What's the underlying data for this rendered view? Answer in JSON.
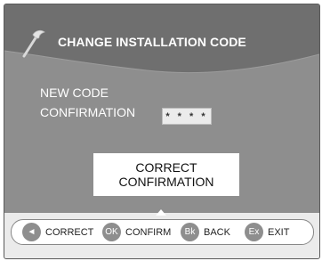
{
  "header": {
    "title": "CHANGE INSTALLATION CODE",
    "icon": "wrench-icon"
  },
  "form": {
    "new_code_label": "NEW CODE",
    "confirmation_label": "CONFIRMATION",
    "confirmation_value": "* * * *"
  },
  "message": {
    "line1": "CORRECT",
    "line2": "CONFIRMATION"
  },
  "footer": {
    "hints": [
      {
        "key": "◄",
        "label": "CORRECT"
      },
      {
        "key": "OK",
        "label": "CONFIRM"
      },
      {
        "key": "Bk",
        "label": "BACK"
      },
      {
        "key": "Ex",
        "label": "EXIT"
      }
    ]
  },
  "colors": {
    "panel": "#8e8e8e",
    "header_wave": "#6f6f6f",
    "footer_strip": "#ebebeb",
    "key_circle": "#8e8e8e"
  }
}
